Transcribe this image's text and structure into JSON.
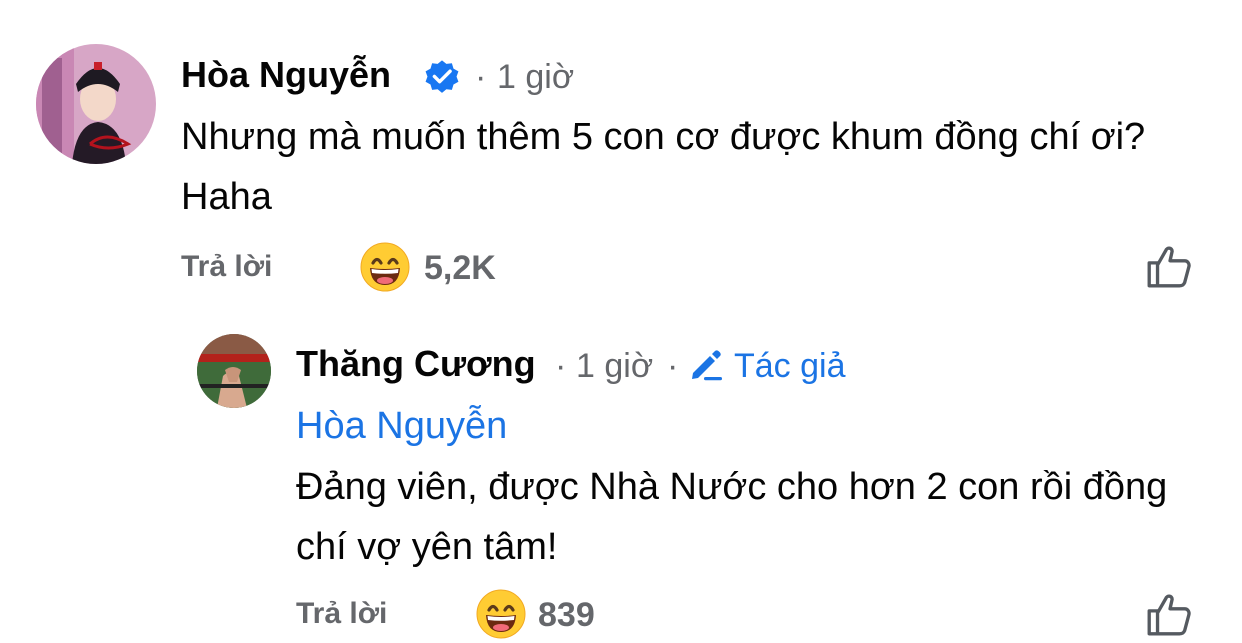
{
  "comment": {
    "author": "Hòa Nguyễn",
    "verified": true,
    "time_sep": "·",
    "time": "1 giờ",
    "text": "Nhưng mà muốn thêm 5 con cơ được khum đồng chí ơi? Haha",
    "reply_label": "Trả lời",
    "reaction_icon": "grinning-face-emoji",
    "reaction_count": "5,2K",
    "like_icon": "thumbs-up-icon"
  },
  "reply": {
    "author": "Thăng Cương",
    "time_sep": "·",
    "time": "1 giờ",
    "author_sep": "·",
    "author_tag": "Tác giả",
    "mention": "Hòa Nguyễn",
    "text": "Đảng viên, được Nhà Nước cho hơn 2 con rồi đồng chí vợ yên tâm!",
    "reply_label": "Trả lời",
    "reaction_icon": "grinning-face-emoji",
    "reaction_count": "839",
    "like_icon": "thumbs-up-icon"
  },
  "colors": {
    "link_blue": "#1b74e4",
    "verified_blue": "#1877f2",
    "meta_gray": "#65676b",
    "text": "#050505"
  }
}
